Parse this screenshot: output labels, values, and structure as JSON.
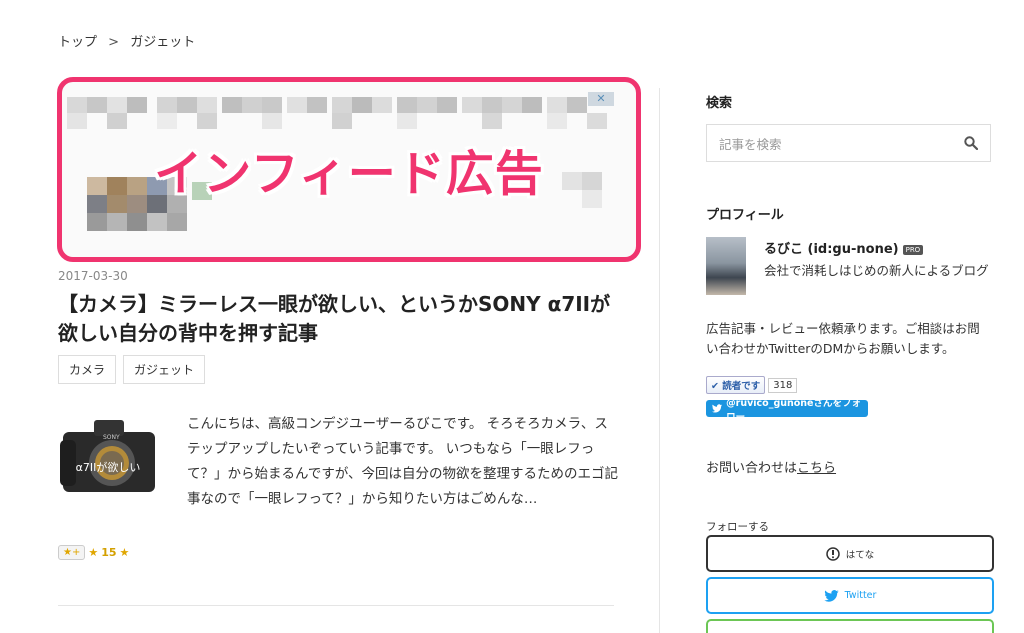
{
  "breadcrumb": {
    "home": "トップ",
    "separator": ">",
    "category": "ガジェット"
  },
  "ad": {
    "label": "インフィード広告"
  },
  "post": {
    "date": "2017-03-30",
    "title": "【カメラ】ミラーレス一眼が欲しい、というかSONY α7IIが欲しい自分の背中を押す記事",
    "tags": [
      "カメラ",
      "ガジェット"
    ],
    "thumbnail_caption": "α7IIが欲しい",
    "thumbnail_brand": "SONY",
    "excerpt": "こんにちは、高級コンデジユーザーるびこです。 そろそろカメラ、ステップアップしたいぞっていう記事です。 いつもなら「一眼レフって？」から始まるんですが、今回は自分の物欲を整理するためのエゴ記事なので「一眼レフって？」から知りたい方はごめんな…",
    "star_button": "★+",
    "star_count": "15"
  },
  "sidebar": {
    "search": {
      "title": "検索",
      "placeholder": "記事を検索"
    },
    "profile": {
      "title": "プロフィール",
      "name": "るびこ (id:gu-none)",
      "badge": "PRO",
      "description": "会社で消耗しはじめの新人によるブログ",
      "note": "広告記事・レビュー依頼承ります。ご相談はお問い合わせかTwitterのDMからお願いします。",
      "reader_button": "読者です",
      "reader_count": "318",
      "twitter_follow": "@ruvico_gunoneさんをフォロー"
    },
    "contact": {
      "prefix": "お問い合わせは",
      "link": "こちら"
    },
    "follow": {
      "label": "フォローする",
      "hatena": "はてな",
      "twitter": "Twitter"
    }
  },
  "colors": {
    "ad_border": "#f0346f",
    "twitter": "#1da1f2",
    "feedly": "#6cc655"
  }
}
